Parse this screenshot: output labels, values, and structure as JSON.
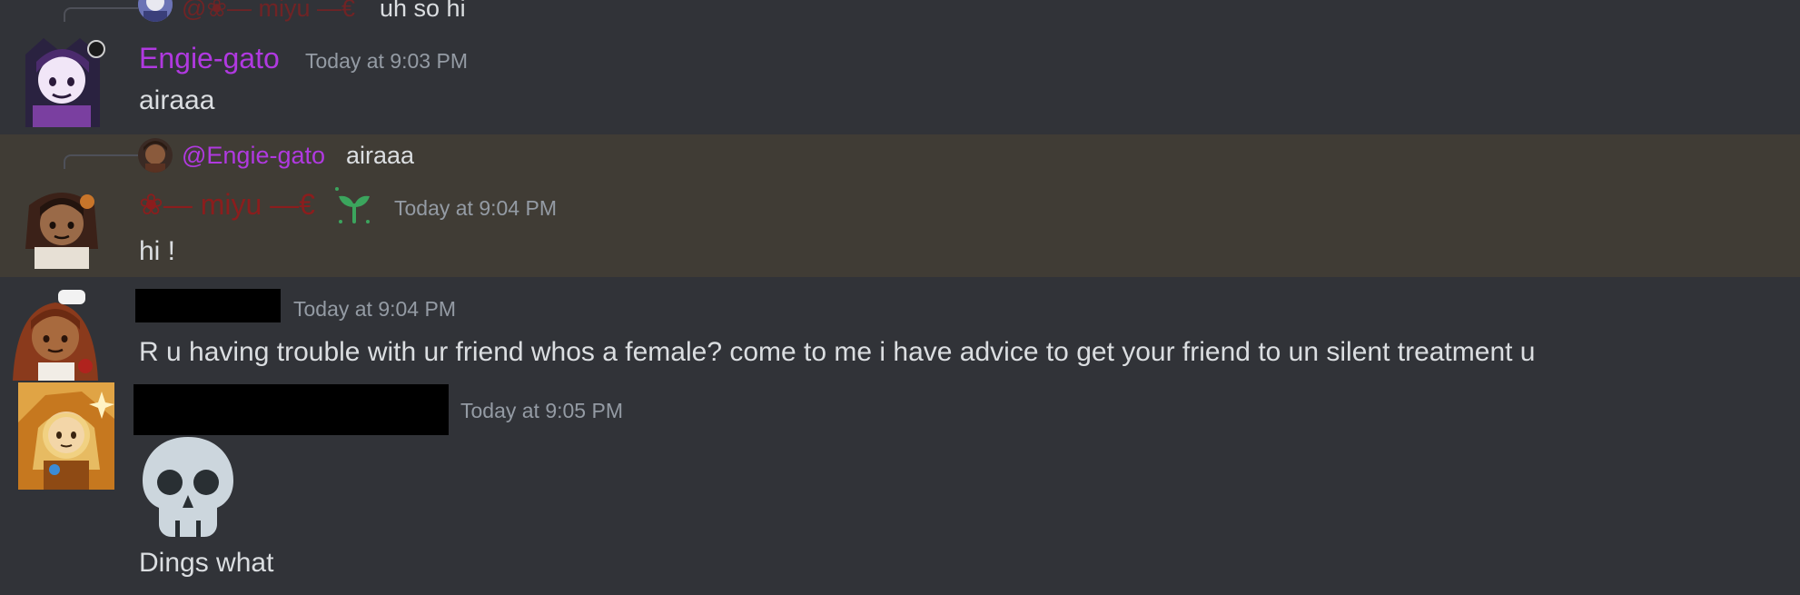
{
  "colors": {
    "background": "#313338",
    "highlight_background": "#403c35",
    "engie_name": "#b039e0",
    "miyu_name": "#8b1d1d",
    "text": "#dbdee1",
    "muted": "#949ba4",
    "badge_green": "#3ba55d",
    "redaction": "#000000"
  },
  "messages": [
    {
      "reply": {
        "name": "@❀— miyu —€",
        "text": "uh so hi"
      }
    },
    {
      "username": "Engie-gato",
      "timestamp": "Today at 9:03 PM",
      "content": "airaaa"
    },
    {
      "reply": {
        "name": "@Engie-gato",
        "text": "airaaa"
      },
      "username": "❀— miyu —€",
      "badge_icon": "sprout-icon",
      "timestamp": "Today at 9:04 PM",
      "content": "hi !"
    },
    {
      "username_redacted": true,
      "timestamp": "Today at 9:04 PM",
      "content": "R u having trouble with ur friend whos a female? come to me i have advice to get your friend to un silent treatment u"
    },
    {
      "username_redacted": true,
      "timestamp": "Today at 9:05 PM",
      "emoji": "skull-emoji",
      "content": "Dings what"
    }
  ]
}
